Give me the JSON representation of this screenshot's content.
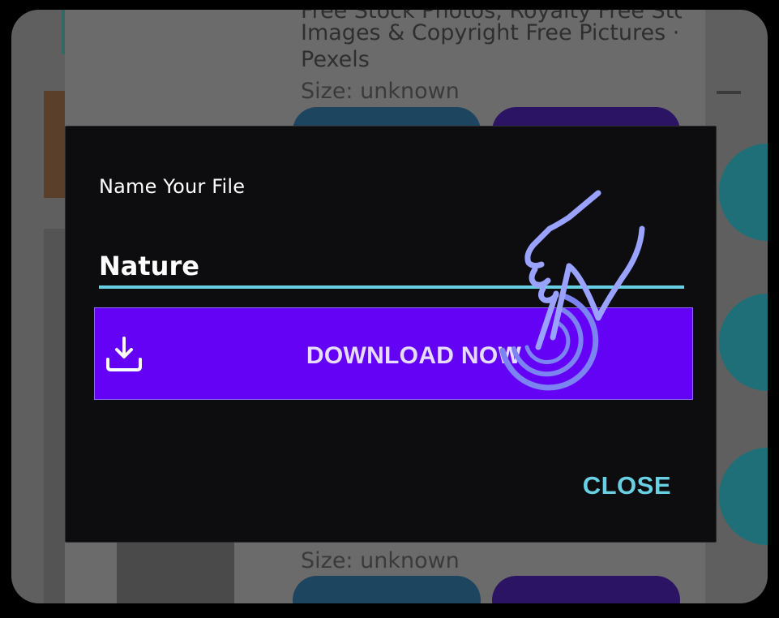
{
  "background": {
    "result_title_lines": [
      "Free Stock Photos, Royalty Free Stock",
      "Images & Copyright Free Pictures ·",
      "Pexels"
    ],
    "size_label_top": "Size: unknown",
    "size_label_bottom": "Size: unknown"
  },
  "dialog": {
    "title": "Name Your File",
    "filename_value": "Nature",
    "download_button_label": "DOWNLOAD NOW",
    "close_button_label": "CLOSE"
  },
  "icons": {
    "download": "download-icon",
    "tap_hint": "tap-hand-icon"
  },
  "colors": {
    "accent_purple": "#6302f5",
    "accent_cyan": "#68d0e2",
    "dialog_background": "#0d0c0f"
  }
}
